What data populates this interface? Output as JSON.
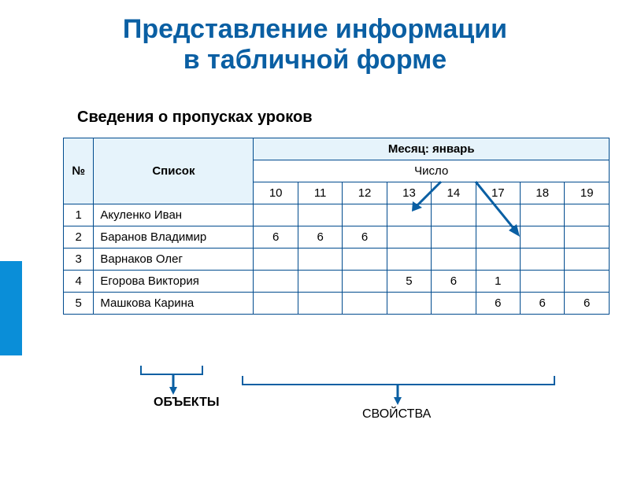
{
  "title_line1": "Представление информации",
  "title_line2": "в табличной форме",
  "subtitle": "Сведения о пропусках уроков",
  "labels": {
    "objects": "ОБЪЕКТЫ",
    "properties": "СВОЙСТВА"
  },
  "table": {
    "col_num": "№",
    "col_list": "Список",
    "month": "Месяц: январь",
    "date_label": "Число",
    "days": [
      "10",
      "11",
      "12",
      "13",
      "14",
      "17",
      "18",
      "19"
    ],
    "rows": [
      {
        "n": "1",
        "name": "Акуленко Иван",
        "v": [
          "",
          "",
          "",
          "",
          "",
          "",
          "",
          ""
        ]
      },
      {
        "n": "2",
        "name": "Баранов Владимир",
        "v": [
          "6",
          "6",
          "6",
          "",
          "",
          "",
          "",
          ""
        ]
      },
      {
        "n": "3",
        "name": "Варнаков Олег",
        "v": [
          "",
          "",
          "",
          "",
          "",
          "",
          "",
          ""
        ]
      },
      {
        "n": "4",
        "name": "Егорова Виктория",
        "v": [
          "",
          "",
          "",
          "5",
          "6",
          "1",
          "",
          ""
        ]
      },
      {
        "n": "5",
        "name": "Машкова Карина",
        "v": [
          "",
          "",
          "",
          "",
          "",
          "6",
          "6",
          "6"
        ]
      }
    ]
  },
  "chart_data": {
    "type": "table",
    "title": "Сведения о пропусках уроков",
    "month": "январь",
    "columns": [
      "№",
      "Список",
      "10",
      "11",
      "12",
      "13",
      "14",
      "17",
      "18",
      "19"
    ],
    "data": [
      [
        1,
        "Акуленко Иван",
        null,
        null,
        null,
        null,
        null,
        null,
        null,
        null
      ],
      [
        2,
        "Баранов Владимир",
        6,
        6,
        6,
        null,
        null,
        null,
        null,
        null
      ],
      [
        3,
        "Варнаков Олег",
        null,
        null,
        null,
        null,
        null,
        null,
        null,
        null
      ],
      [
        4,
        "Егорова Виктория",
        null,
        null,
        null,
        5,
        6,
        1,
        null,
        null
      ],
      [
        5,
        "Машкова Карина",
        null,
        null,
        null,
        null,
        null,
        6,
        6,
        6
      ]
    ]
  }
}
